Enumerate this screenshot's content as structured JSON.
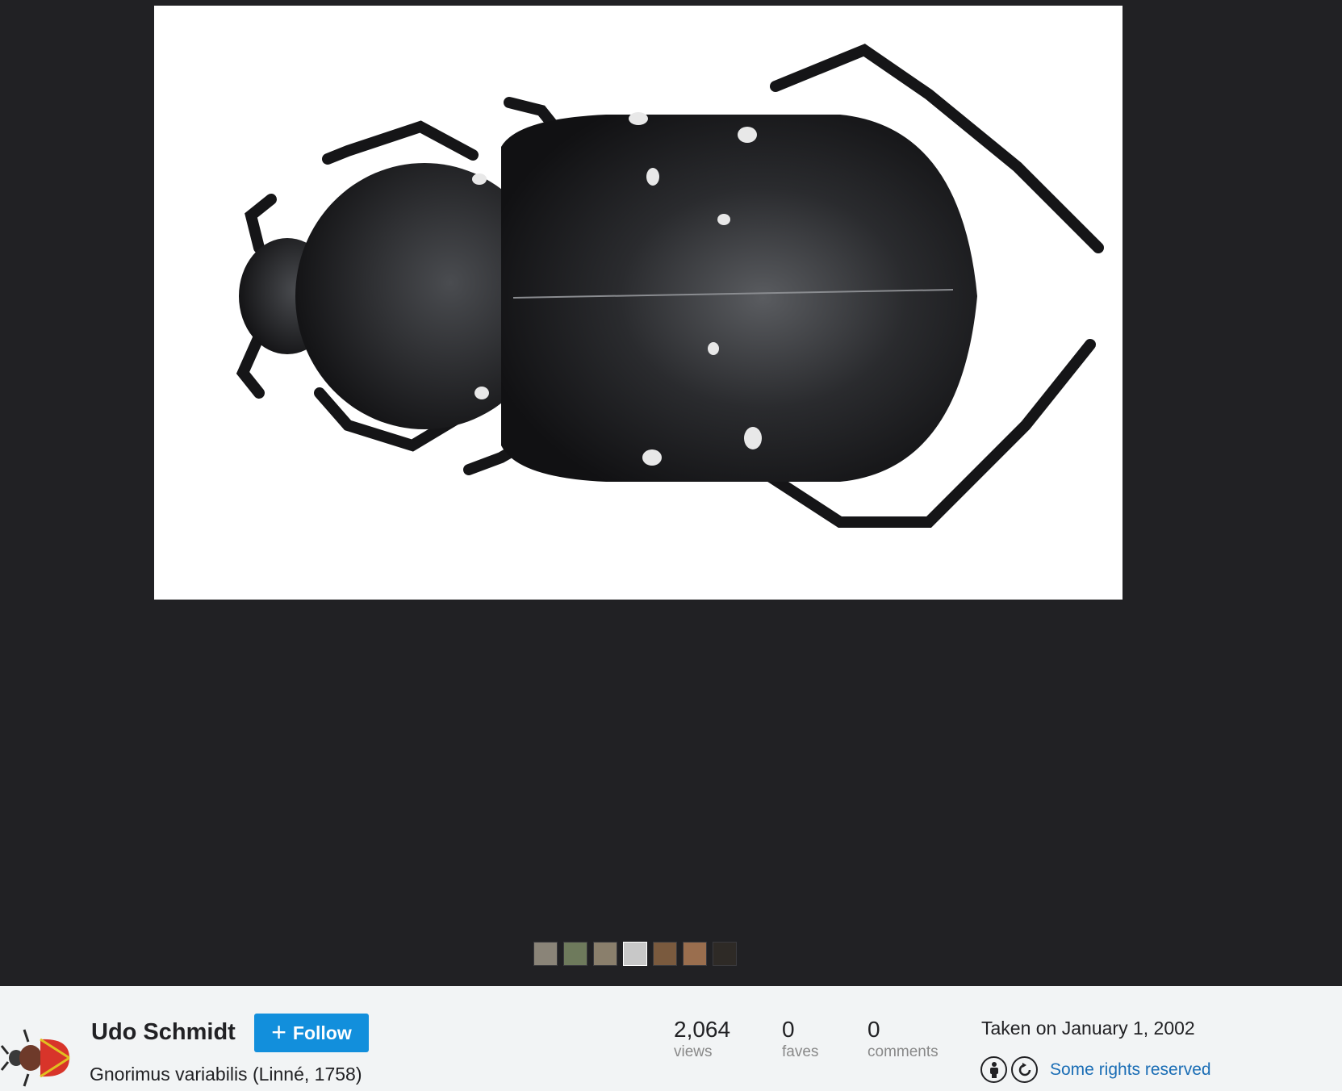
{
  "photo": {
    "alt": "Gnorimus variabilis (Linné, 1758)",
    "background": "#ffffff",
    "subject_color": "#1c1c1e"
  },
  "filmstrip": {
    "thumbnails": [
      {
        "color": "#8a8478",
        "selected": false
      },
      {
        "color": "#6e7a5c",
        "selected": false
      },
      {
        "color": "#8a7f6c",
        "selected": false
      },
      {
        "color": "#c8c8c8",
        "selected": true
      },
      {
        "color": "#7a5a3e",
        "selected": false
      },
      {
        "color": "#9a6e4e",
        "selected": false
      },
      {
        "color": "#2e2a26",
        "selected": false
      }
    ]
  },
  "owner": {
    "name": "Udo Schmidt",
    "follow_label": "Follow",
    "follow_icon": "plus-icon"
  },
  "title": "Gnorimus variabilis (Linné, 1758)",
  "stats": {
    "views": {
      "value": "2,064",
      "label": "views"
    },
    "faves": {
      "value": "0",
      "label": "faves"
    },
    "comments": {
      "value": "0",
      "label": "comments"
    }
  },
  "taken": "Taken on January 1, 2002",
  "license": {
    "icons": [
      "cc-by-icon",
      "cc-sa-icon"
    ],
    "label": "Some rights reserved"
  },
  "colors": {
    "stage_bg": "#212124",
    "info_bg": "#f2f4f5",
    "follow_btn": "#128fdc",
    "link": "#1a6db5"
  }
}
